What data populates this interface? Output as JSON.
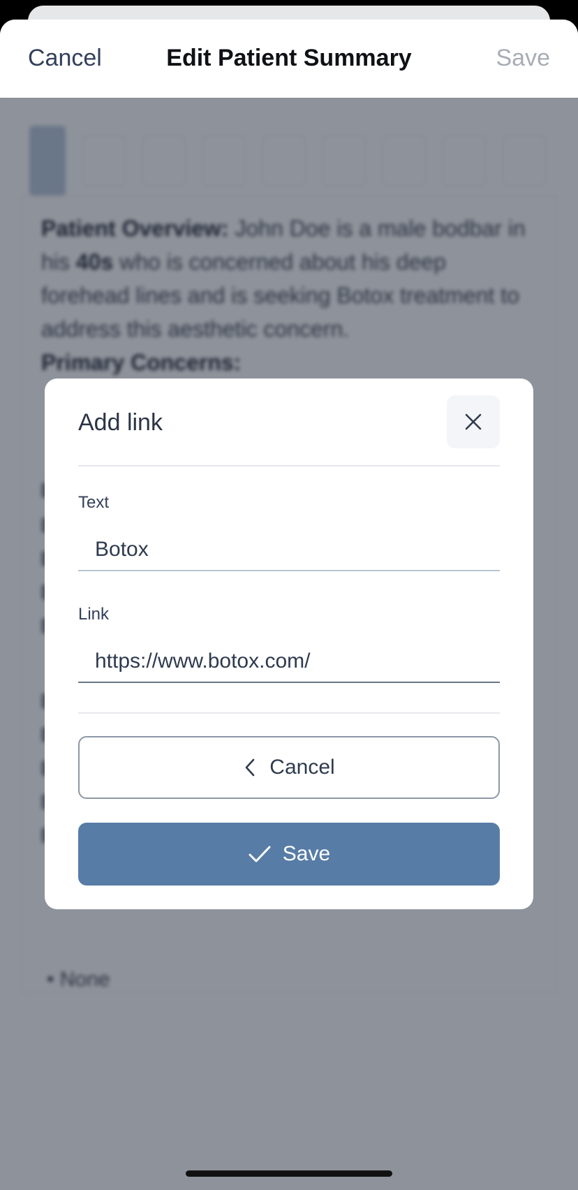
{
  "nav": {
    "cancel_label": "Cancel",
    "title": "Edit Patient Summary",
    "save_label": "Save"
  },
  "editor": {
    "overview_heading": "Patient Overview:",
    "overview_text": " John Doe is a male bodbar in his ",
    "overview_age": "40s",
    "overview_text2": " who is concerned about his deep forehead lines and is seeking Botox treatment to address this aesthetic concern.",
    "concerns_heading": "Primary Concerns:",
    "bullet_text": "None"
  },
  "dialog": {
    "title": "Add link",
    "close_icon": "close-icon",
    "text_label": "Text",
    "text_value": "Botox",
    "link_label": "Link",
    "link_value": "https://www.botox.com/",
    "cancel_label": "Cancel",
    "save_label": "Save"
  },
  "colors": {
    "primary": "#577ca6",
    "text": "#2f3a4f",
    "overlay": "rgba(30,38,54,0.5)"
  }
}
